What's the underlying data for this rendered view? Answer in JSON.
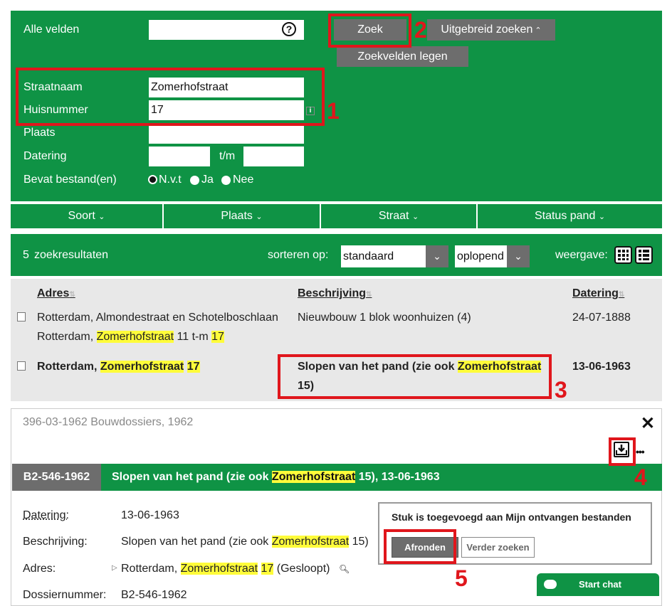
{
  "search": {
    "all_fields_label": "Alle velden",
    "all_fields_value": "",
    "help_icon": "?",
    "street_label": "Straatnaam",
    "street_value": "Zomerhofstraat",
    "number_label": "Huisnummer",
    "number_value": "17",
    "info_icon": "i",
    "place_label": "Plaats",
    "place_value": "",
    "date_label": "Datering",
    "date_from": "",
    "date_sep": "t/m",
    "date_to": "",
    "file_label": "Bevat bestand(en)",
    "radio_options": [
      "N.v.t",
      "Ja",
      "Nee"
    ],
    "radio_selected": "N.v.t",
    "search_button": "Zoek",
    "advanced_button": "Uitgebreid zoeken",
    "clear_button": "Zoekvelden legen"
  },
  "facets": [
    "Soort",
    "Plaats",
    "Straat",
    "Status pand"
  ],
  "results": {
    "count": "5",
    "count_label": "zoekresultaten",
    "sort_label": "sorteren op:",
    "sort_value": "standaard",
    "order_value": "oplopend",
    "view_label": "weergave:"
  },
  "table": {
    "headers": [
      "Adres",
      "Beschrijving",
      "Datering"
    ],
    "rows": [
      {
        "address_line1": "Rotterdam, Almondestraat en Schotelboschlaan",
        "address_line2_pre": "Rotterdam, ",
        "address_line2_hl1": "Zomerhofstraat",
        "address_line2_mid": " 11 t-m ",
        "address_line2_hl2": "17",
        "description": "Nieuwbouw 1 blok woonhuizen (4)",
        "date": "24-07-1888"
      },
      {
        "address_pre": "Rotterdam, ",
        "address_hl1": "Zomerhofstraat",
        "address_sp": " ",
        "address_hl2": "17",
        "description_pre": "Slopen van het pand (zie ook ",
        "description_hl": "Zomerhofstraat",
        "description_line2": "15)",
        "date": "13-06-1963"
      }
    ]
  },
  "detail": {
    "archive": "396-03-1962 Bouwdossiers, 1962",
    "close_icon": "✕",
    "more_icon": "•••",
    "code": "B2-546-1962",
    "title_pre": "Slopen van het pand (zie ook ",
    "title_hl": "Zomerhofstraat",
    "title_post": " 15), 13-06-1963",
    "date_label": "Datering:",
    "date_value": "13-06-1963",
    "desc_label": "Beschrijving:",
    "desc_pre": "Slopen van het pand (zie ook ",
    "desc_hl": "Zomerhofstraat",
    "desc_post": " 15)",
    "address_label": "Adres:",
    "address_pre": "Rotterdam, ",
    "address_hl1": "Zomerhofstraat",
    "address_sp": " ",
    "address_hl2": "17",
    "address_post": " (Gesloopt)",
    "dossier_label": "Dossiernummer:",
    "dossier_value": "B2-546-1962"
  },
  "popup": {
    "message": "Stuk is toegevoegd aan Mijn ontvangen bestanden",
    "finish_button": "Afronden",
    "continue_button": "Verder zoeken"
  },
  "chat": {
    "label": "Start chat"
  },
  "annotations": [
    "1",
    "2",
    "3",
    "4",
    "5"
  ],
  "colors": {
    "green": "#0f9345",
    "grey_button": "#6d6d6d",
    "highlight": "#fffc3a",
    "annotation_red": "#e0161c"
  }
}
